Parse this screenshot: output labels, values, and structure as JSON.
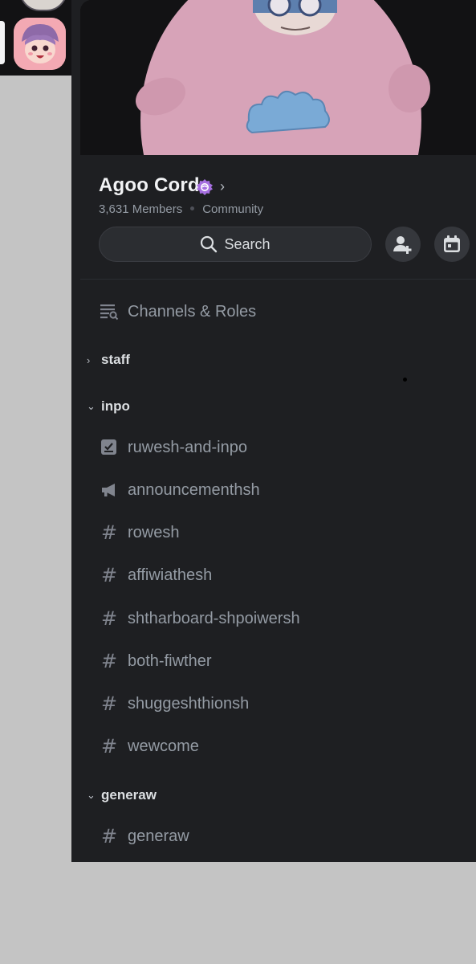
{
  "server": {
    "name": "Agoo Cord",
    "members": "3,631 Members",
    "type": "Community"
  },
  "search": {
    "label": "Search"
  },
  "menu": {
    "channels_roles": "Channels & Roles"
  },
  "categories": [
    {
      "name": "staff",
      "collapsed": true,
      "channels": []
    },
    {
      "name": "inpo",
      "collapsed": false,
      "channels": [
        {
          "name": "ruwesh-and-inpo",
          "icon": "rules-icon"
        },
        {
          "name": "announcementhsh",
          "icon": "megaphone-icon"
        },
        {
          "name": "rowesh",
          "icon": "hash-icon"
        },
        {
          "name": "affiwiathesh",
          "icon": "hash-icon"
        },
        {
          "name": "shtharboard-shpoiwersh",
          "icon": "hash-icon"
        },
        {
          "name": "both-fiwther",
          "icon": "hash-icon"
        },
        {
          "name": "shuggeshthionsh",
          "icon": "hash-icon"
        },
        {
          "name": "wewcome",
          "icon": "hash-icon"
        }
      ]
    },
    {
      "name": "generaw",
      "collapsed": false,
      "channels": [
        {
          "name": "generaw",
          "icon": "hash-icon"
        }
      ]
    }
  ],
  "colors": {
    "panel_bg": "#1e1f22",
    "rail_bg": "#121214",
    "outside_bg": "#c4c4c4",
    "muted_text": "#949ba4",
    "badge_purple": "#a66fe0",
    "banner_character_pink": "#d7a3b8",
    "banner_character_blue": "#7aaad6"
  }
}
